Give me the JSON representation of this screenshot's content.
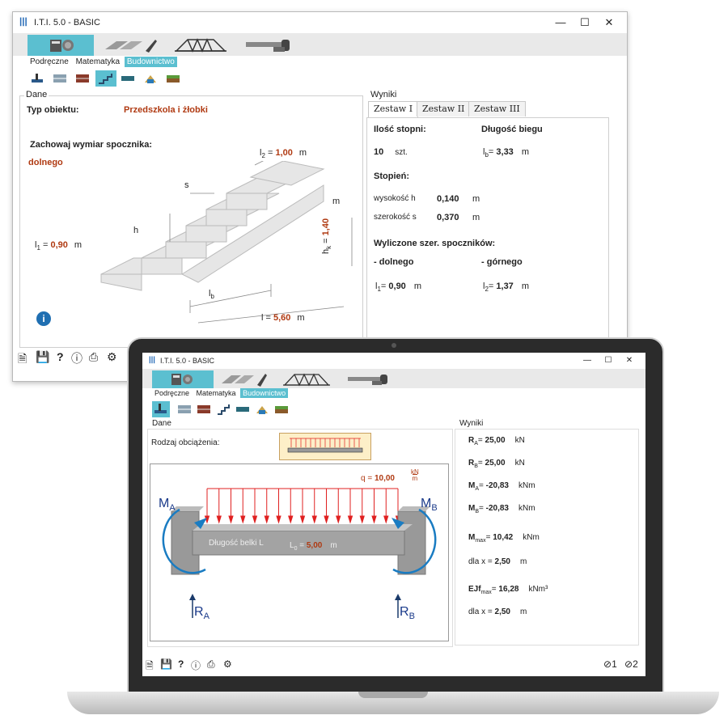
{
  "back_window": {
    "title": "I.T.I. 5.0 - BASIC",
    "menu_tabs": [
      "Podręczne",
      "Matematyka",
      "Budownictwo"
    ],
    "selected_tab": "Budownictwo",
    "dane": {
      "group_label": "Dane",
      "typ_obiektu_label": "Typ obiektu:",
      "typ_obiektu_value": "Przedszkola i żłobki",
      "zachowaj_label": "Zachowaj wymiar spocznika:",
      "zachowaj_value": "dolnego",
      "l2_label": "l",
      "l2_sub": "2",
      "l2_value": "1,00",
      "l2_unit": "m",
      "s_label": "s",
      "h_label": "h",
      "m_label": "m",
      "hk_label": "h",
      "hk_sub": "k",
      "hk_value": "1,40",
      "l1_label": "l",
      "l1_sub": "1",
      "l1_value": "0,90",
      "l1_unit": "m",
      "lb_label": "l",
      "lb_sub": "b",
      "l_label": "l",
      "l_value": "5,60",
      "l_unit": "m"
    },
    "wyniki": {
      "group_label": "Wyniki",
      "tabs": [
        "Zestaw I",
        "Zestaw II",
        "Zestaw III"
      ],
      "ilosc_stopni_label": "Ilość stopni:",
      "ilosc_stopni_value": "10",
      "ilosc_stopni_unit": "szt.",
      "dlugosc_biegu_label": "Długość biegu",
      "lb_value": "3,33",
      "lb_unit": "m",
      "stopien_label": "Stopień:",
      "wysokosc_label": "wysokość  h",
      "wysokosc_value": "0,140",
      "wysokosc_unit": "m",
      "szerokosc_label": "szerokość  s",
      "szerokosc_value": "0,370",
      "szerokosc_unit": "m",
      "wyliczone_label": "Wyliczone szer. spoczników:",
      "dolnego_label": "- dolnego",
      "gornego_label": "- górnego",
      "l1_value": "0,90",
      "l1_unit": "m",
      "l2_value": "1,37",
      "l2_unit": "m"
    }
  },
  "front_window": {
    "title": "I.T.I. 5.0 - BASIC",
    "menu_tabs": [
      "Podręczne",
      "Matematyka",
      "Budownictwo"
    ],
    "selected_tab": "Budownictwo",
    "dane": {
      "group_label": "Dane",
      "rodzaj_label": "Rodzaj obciążenia:",
      "q_label": "q  =",
      "q_value": "10,00",
      "q_unit_num": "kN",
      "q_unit_den": "m",
      "ma_label": "M",
      "ma_sub": "A",
      "mb_label": "M",
      "mb_sub": "B",
      "beam_label": "Długość belki L",
      "l0_label": "L",
      "l0_sub": "0",
      "l0_value": "5,00",
      "l0_unit": "m",
      "ra_label": "R",
      "ra_sub": "A",
      "rb_label": "R",
      "rb_sub": "B"
    },
    "wyniki": {
      "group_label": "Wyniki",
      "rows": [
        {
          "name": "R",
          "sub": "A",
          "value": "25,00",
          "unit": "kN"
        },
        {
          "name": "R",
          "sub": "B",
          "value": "25,00",
          "unit": "kN"
        },
        {
          "name": "M",
          "sub": "A",
          "value": "-20,83",
          "unit": "kNm"
        },
        {
          "name": "M",
          "sub": "B",
          "value": "-20,83",
          "unit": "kNm"
        },
        {
          "name": "M",
          "sub": "max",
          "value": "10,42",
          "unit": "kNm"
        },
        {
          "name": "dla x",
          "sub": "",
          "value": "2,50",
          "unit": "m"
        },
        {
          "name": "EJf",
          "sub": "max",
          "value": "16,28",
          "unit": "kNm³"
        },
        {
          "name": "dla x",
          "sub": "",
          "value": "2,50",
          "unit": "m"
        }
      ]
    },
    "status": {
      "s1": "1",
      "s2": "2"
    }
  },
  "colors": {
    "accent": "#5bbfd0",
    "value_red": "#b03a12",
    "load_red": "#e02020",
    "moment_blue": "#1a7cc2"
  }
}
